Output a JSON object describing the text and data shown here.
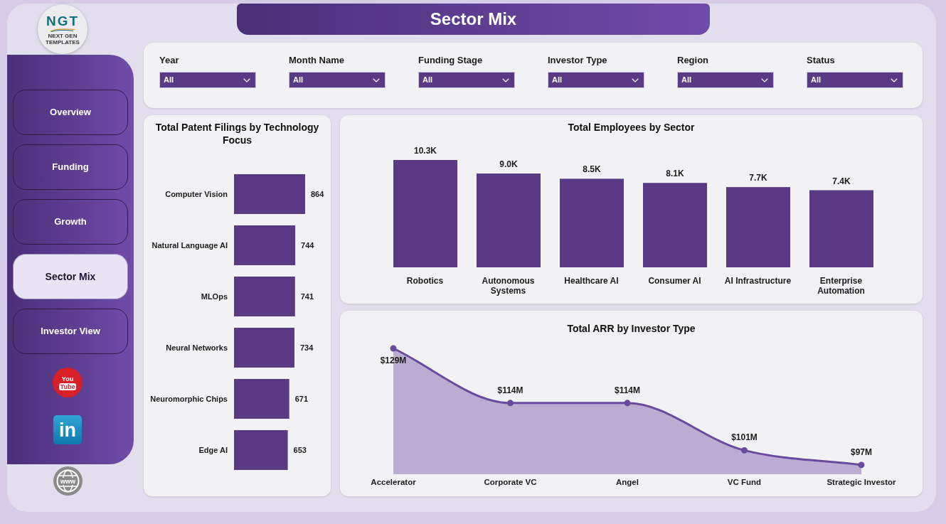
{
  "logo": {
    "mark": "NGT",
    "tagline": "NEXT GEN TEMPLATES"
  },
  "header": {
    "title": "Sector Mix"
  },
  "sidebar": {
    "items": [
      {
        "label": "Overview",
        "selected": false
      },
      {
        "label": "Funding",
        "selected": false
      },
      {
        "label": "Growth",
        "selected": false
      },
      {
        "label": "Sector Mix",
        "selected": true
      },
      {
        "label": "Investor View",
        "selected": false
      }
    ],
    "links": [
      {
        "kind": "video",
        "lines": [
          "You",
          "Tube"
        ]
      },
      {
        "kind": "social",
        "lines": [
          "in"
        ]
      }
    ]
  },
  "footer_link": {
    "kind": "web",
    "lines": [
      "www"
    ]
  },
  "filters": [
    {
      "label": "Year",
      "value": "All"
    },
    {
      "label": "Month Name",
      "value": "All"
    },
    {
      "label": "Funding Stage",
      "value": "All"
    },
    {
      "label": "Investor Type",
      "value": "All"
    },
    {
      "label": "Region",
      "value": "All"
    },
    {
      "label": "Status",
      "value": "All"
    }
  ],
  "patent_chart": {
    "chart_data": {
      "type": "bar",
      "orientation": "horizontal",
      "title": "Total Patent Filings by Technology Focus",
      "categories": [
        "Computer Vision",
        "Natural Language AI",
        "MLOps",
        "Neural Networks",
        "Neuromorphic Chips",
        "Edge AI"
      ],
      "values": [
        864,
        744,
        741,
        734,
        671,
        653
      ],
      "data_labels": true
    }
  },
  "employees_chart": {
    "chart_data": {
      "type": "bar",
      "orientation": "vertical",
      "title": "Total Employees by Sector",
      "categories": [
        "Robotics",
        "Autonomous Systems",
        "Healthcare AI",
        "Consumer AI",
        "AI Infrastructure",
        "Enterprise Automation"
      ],
      "values": [
        10300,
        9000,
        8500,
        8100,
        7700,
        7400
      ],
      "value_labels": [
        "10.3K",
        "9.0K",
        "8.5K",
        "8.1K",
        "7.7K",
        "7.4K"
      ]
    }
  },
  "arr_chart": {
    "chart_data": {
      "type": "area",
      "title": "Total ARR by Investor Type",
      "categories": [
        "Accelerator",
        "Corporate VC",
        "Angel",
        "VC Fund",
        "Strategic Investor"
      ],
      "values": [
        129,
        114,
        114,
        101,
        97
      ],
      "value_labels": [
        "$129M",
        "$114M",
        "$114M",
        "$101M",
        "$97M"
      ]
    }
  }
}
